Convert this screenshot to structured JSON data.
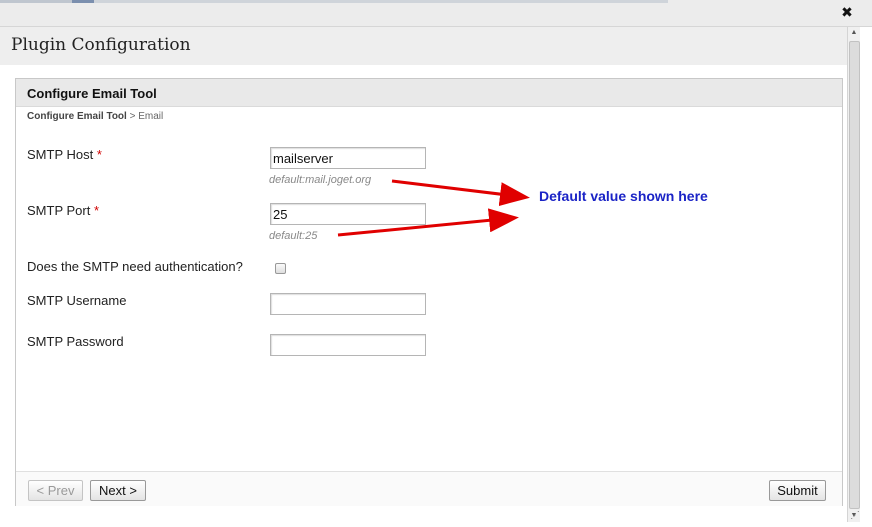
{
  "dialog": {
    "title": "Plugin Configuration",
    "close_glyph": "✖"
  },
  "panel": {
    "title": "Configure Email Tool",
    "breadcrumb": {
      "root": "Configure Email Tool",
      "separator": " > ",
      "current": "Email"
    }
  },
  "form": {
    "smtp_host": {
      "label": "SMTP Host",
      "required_mark": "*",
      "value": "mailserver",
      "hint": "default:mail.joget.org"
    },
    "smtp_port": {
      "label": "SMTP Port",
      "required_mark": "*",
      "value": "25",
      "hint": "default:25"
    },
    "smtp_auth": {
      "label": "Does the SMTP need authentication?",
      "checked": false
    },
    "smtp_username": {
      "label": "SMTP Username",
      "value": ""
    },
    "smtp_password": {
      "label": "SMTP Password",
      "value": ""
    }
  },
  "buttons": {
    "prev": "< Prev",
    "next": "Next >",
    "submit": "Submit"
  },
  "annotation": {
    "text": "Default value shown here",
    "color": "#1a23c6",
    "arrow_color": "#e00000"
  },
  "icons": {
    "close": "close-icon",
    "scroll_up": "chevron-up-icon",
    "scroll_down": "chevron-down-icon"
  }
}
